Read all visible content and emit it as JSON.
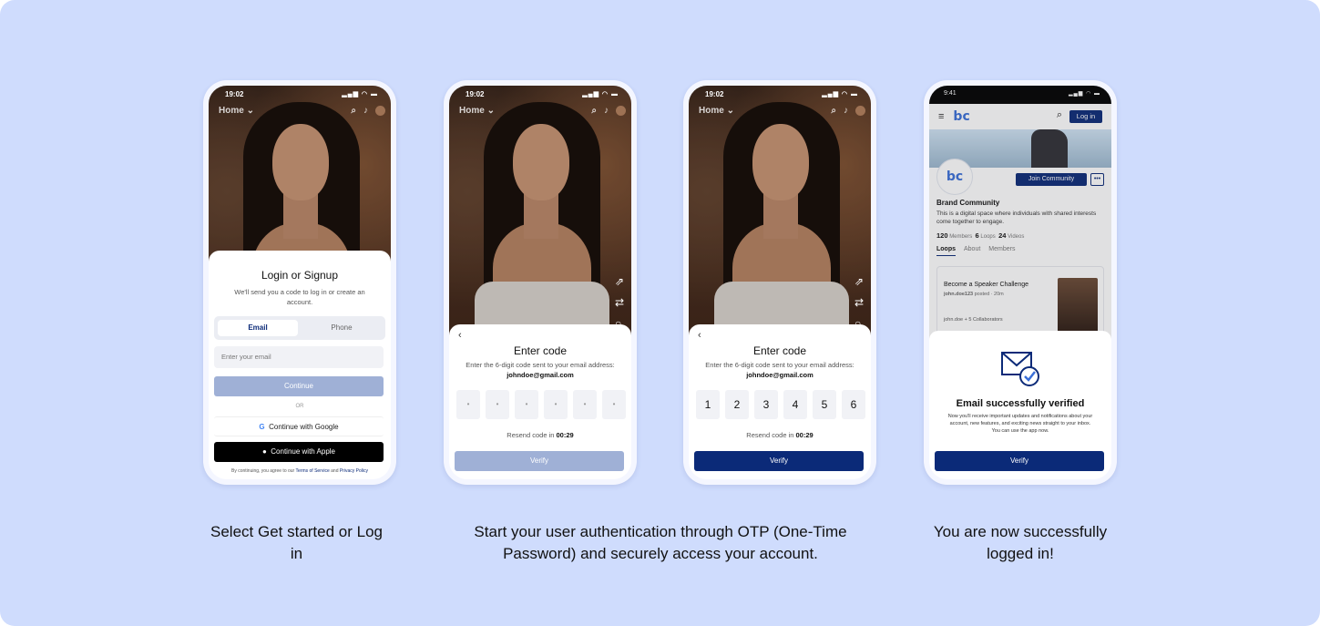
{
  "screens": [
    {
      "status_time": "19:02",
      "nav_title": "Home",
      "title": "Login or Signup",
      "subtitle": "We'll send you a code to log in or create an account.",
      "tabs": [
        "Email",
        "Phone"
      ],
      "email_placeholder": "Enter your email",
      "continue_label": "Continue",
      "or_label": "OR",
      "google_label": "Continue with Google",
      "apple_label": "Continue with Apple",
      "terms_prefix": "By continuing, you agree to our ",
      "terms_link": "Terms of Service",
      "terms_and": " and ",
      "privacy_link": "Privacy Policy"
    },
    {
      "status_time": "19:02",
      "nav_title": "Home",
      "title": "Enter code",
      "subtitle_prefix": "Enter the 6-digit code sent to your email address: ",
      "email": "johndoe@gmail.com",
      "otp": [
        "•",
        "•",
        "•",
        "•",
        "•",
        "•"
      ],
      "resend_prefix": "Resend code in ",
      "resend_time": "00:29",
      "verify_label": "Verify"
    },
    {
      "status_time": "19:02",
      "nav_title": "Home",
      "title": "Enter code",
      "subtitle_prefix": "Enter the 6-digit code sent to your email address: ",
      "email": "johndoe@gmail.com",
      "otp": [
        "1",
        "2",
        "3",
        "4",
        "5",
        "6"
      ],
      "resend_prefix": "Resend code in ",
      "resend_time": "00:29",
      "verify_label": "Verify"
    },
    {
      "status_time": "9:41",
      "logo": "bc",
      "login_label": "Log in",
      "join_label": "Join Community",
      "more_label": "•••",
      "community_name": "Brand Community",
      "community_desc": "This is a digital space where individuals with shared interests come together to engage.",
      "stats": [
        {
          "value": "120",
          "label": "Members"
        },
        {
          "value": "6",
          "label": "Loops"
        },
        {
          "value": "24",
          "label": "Videos"
        }
      ],
      "tabs": [
        "Loops",
        "About",
        "Members"
      ],
      "card_title": "Become a Speaker Challenge",
      "card_author": "john.doe123",
      "card_meta": " posted · 20m",
      "card_collab": "john.doe + 5 Collaborators",
      "verified_title": "Email successfully verified",
      "verified_sub": "Now you'll receive important updates and notifications about your account, new features, and exciting news straight to your inbox. You can use the app now.",
      "verify_label": "Verify"
    }
  ],
  "captions": [
    "Select Get started or Log in",
    "Start your user authentication through OTP (One-Time Password) and securely access your account.",
    "You are now successfully logged in!"
  ],
  "colors": {
    "background": "#cfdcfd",
    "primary": "#0b2a78",
    "disabled": "#9fb0d6"
  }
}
